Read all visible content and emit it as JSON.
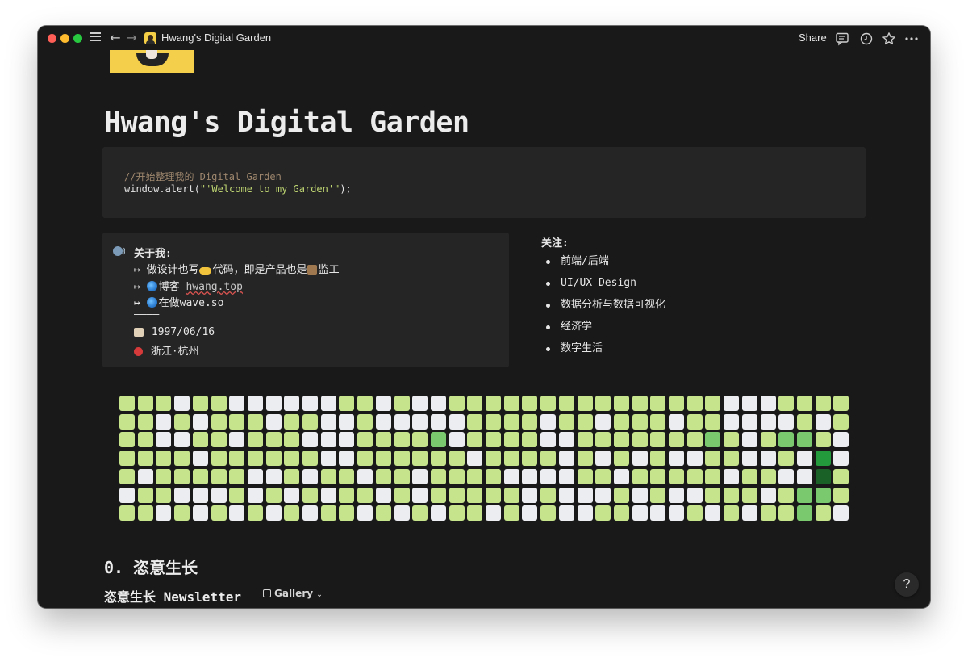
{
  "titlebar": {
    "title": "Hwang's Digital Garden",
    "share_label": "Share"
  },
  "page": {
    "title": "Hwang's Digital Garden",
    "code": {
      "comment": "//开始整理我的 Digital Garden",
      "call_prefix": "window.alert(",
      "call_string": "\"'Welcome to my Garden'\"",
      "call_suffix": ");"
    },
    "about": {
      "heading": "关于我:",
      "line1_a": "↦ 做设计也写",
      "line1_b": "代码，即是产品也是",
      "line1_c": "监工",
      "line2_a": "↦ ",
      "line2_b": "博客 ",
      "line2_link": "hwang.top",
      "line3_a": "↦ ",
      "line3_b": "在做wave.so",
      "divider": "————",
      "birthday": "1997/06/16",
      "location": "浙江·杭州"
    },
    "follow": {
      "heading": "关注:",
      "items": [
        "前端/后端",
        "UI/UX Design",
        "数据分析与数据可视化",
        "经济学",
        "数字生活"
      ]
    },
    "section_heading": "0. 恣意生长",
    "subsection_heading": "恣意生长 Newsletter",
    "view_label": "Gallery",
    "help_label": "?"
  },
  "colors": {
    "level0": "#ebedf0",
    "level1": "#c6e48b",
    "level2": "#7bc96f",
    "level3": "#239a3b",
    "level4": "#196127",
    "background": "#191919",
    "block": "#252525"
  },
  "contribution_grid": {
    "columns": 40,
    "rows": 7,
    "levels": [
      "1110110000001101001111111111111110001111000",
      "1101011101100100000111101101110110000101000",
      "1100110111000111120111100111111121012210",
      "1111011111100111111011110101010011001030",
      "1011111001011011011110000110111110110041",
      "0110001010101101011111010001010011101221",
      "1101010101011010101101010011000101011210"
    ]
  }
}
